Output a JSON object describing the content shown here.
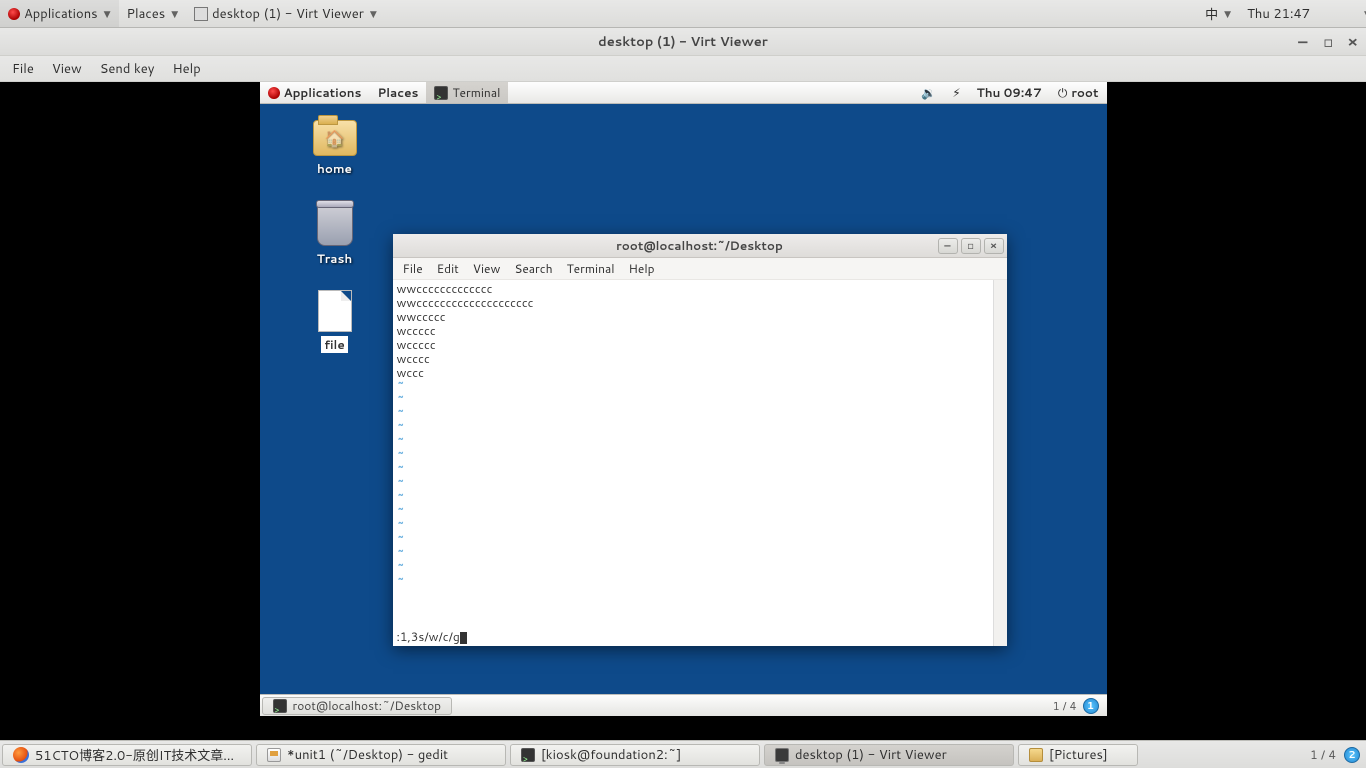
{
  "host": {
    "topbar": {
      "applications": "Applications",
      "places": "Places",
      "running_app": "desktop (1) - Virt Viewer",
      "ime": "中",
      "clock": "Thu 21:47"
    },
    "bottombar": {
      "tasks": [
        {
          "label": "51CTO博客2.0-原创IT技术文章…",
          "icon": "firefox"
        },
        {
          "label": "*unit1 (~/Desktop) - gedit",
          "icon": "gedit"
        },
        {
          "label": "[kiosk@foundation2:~]",
          "icon": "terminal"
        },
        {
          "label": "desktop (1) - Virt Viewer",
          "icon": "monitor",
          "active": true
        },
        {
          "label": "[Pictures]",
          "icon": "folder"
        }
      ],
      "pager": "1 / 4",
      "ws_badge": "2"
    }
  },
  "virt": {
    "title": "desktop (1) - Virt Viewer",
    "menu": {
      "file": "File",
      "view": "View",
      "sendkey": "Send key",
      "help": "Help"
    }
  },
  "guest": {
    "topbar": {
      "applications": "Applications",
      "places": "Places",
      "terminal": "Terminal",
      "clock": "Thu 09:47",
      "user": "root"
    },
    "desktop_icons": {
      "home": "home",
      "trash": "Trash",
      "file": "file"
    },
    "terminal": {
      "title": "root@localhost:~/Desktop",
      "menu": {
        "file": "File",
        "edit": "Edit",
        "view": "View",
        "search": "Search",
        "terminal": "Terminal",
        "help": "Help"
      },
      "lines": [
        "wwccccccccccccc",
        "wwcccccccccccccccccccc",
        "wwccccc",
        "wccccc",
        "wccccc",
        "wcccc",
        "wccc"
      ],
      "command": ":1,3s/w/c/g"
    },
    "bottombar": {
      "task": "root@localhost:~/Desktop",
      "pager": "1 / 4",
      "ws_badge": "1"
    }
  }
}
